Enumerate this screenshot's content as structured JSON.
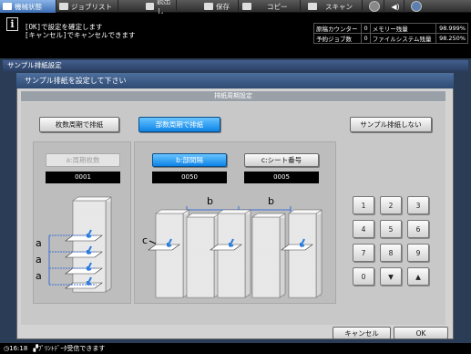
{
  "tabs": [
    {
      "label": "機械状態",
      "icon": "machine-status-icon",
      "active": true
    },
    {
      "label": "ジョブリスト",
      "icon": "job-list-icon"
    },
    {
      "label": "読出し",
      "icon": "recall-icon"
    },
    {
      "label": "保存",
      "icon": "store-icon"
    },
    {
      "label": "コピー",
      "icon": "copy-icon"
    },
    {
      "label": "スキャン",
      "icon": "scan-icon"
    }
  ],
  "message": {
    "line1": "[OK]で設定を確定します",
    "line2": "[キャンセル]でキャンセルできます"
  },
  "counters": [
    {
      "label": "原稿カウンター",
      "value": "0",
      "label2": "メモリー残量",
      "value2": "98.999%"
    },
    {
      "label": "予約ジョブ数",
      "value": "0",
      "label2": "ファイルシステム残量",
      "value2": "98.250%"
    }
  ],
  "window_title": "サンプル排紙設定",
  "dialog": {
    "header": "サンプル排紙を設定して下さい",
    "panel_header": "排紙周期設定",
    "mode_buttons": {
      "sheets": "枚数周期で排紙",
      "copies": "部数周期で排紙",
      "none": "サンプル排紙しない"
    },
    "field_a": {
      "label": "a:周期枚数",
      "value": "0001"
    },
    "field_b": {
      "label": "b:部間隔",
      "value": "0050"
    },
    "field_c": {
      "label": "c:シート番号",
      "value": "0005"
    },
    "diagram_labels": {
      "a": "a",
      "b": "b",
      "c": "c"
    }
  },
  "keypad": {
    "keys": [
      "1",
      "2",
      "3",
      "4",
      "5",
      "6",
      "7",
      "8",
      "9",
      "0",
      "▼",
      "▲"
    ]
  },
  "footer": {
    "cancel": "キャンセル",
    "ok": "OK"
  },
  "status": {
    "time": "16:18",
    "text": "ﾌﾟﾘﾝﾄﾃﾞｰﾀ受信できます"
  },
  "colors": {
    "accent": "#1e95f0",
    "arrow": "#2a7fe0"
  }
}
